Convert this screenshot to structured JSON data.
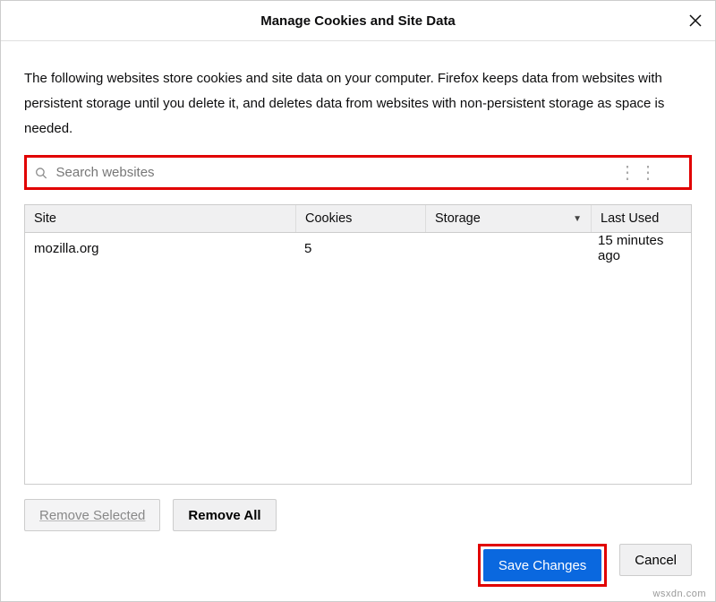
{
  "header": {
    "title": "Manage Cookies and Site Data"
  },
  "description": "The following websites store cookies and site data on your computer. Firefox keeps data from websites with persistent storage until you delete it, and deletes data from websites with non-persistent storage as space is needed.",
  "search": {
    "placeholder": "Search websites",
    "value": ""
  },
  "columns": {
    "site": "Site",
    "cookies": "Cookies",
    "storage": "Storage",
    "last_used": "Last Used"
  },
  "rows": [
    {
      "site": "mozilla.org",
      "cookies": "5",
      "storage": "",
      "last_used": "15 minutes ago"
    }
  ],
  "buttons": {
    "remove_selected": "Remove Selected",
    "remove_all": "Remove All",
    "save": "Save Changes",
    "cancel": "Cancel"
  },
  "watermark": "wsxdn.com"
}
